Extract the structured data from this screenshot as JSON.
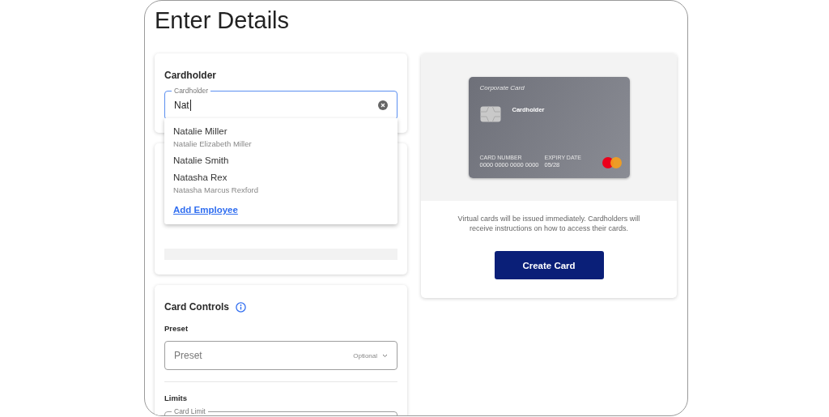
{
  "page_title": "Enter Details",
  "cardholder_section": {
    "heading": "Cardholder",
    "field": {
      "label": "Cardholder",
      "value": "Nat",
      "focused": true
    },
    "suggestions": [
      {
        "kind": "person",
        "name": "Natalie Miller",
        "full_name": "Natalie Elizabeth Miller"
      },
      {
        "kind": "person",
        "name": "Natalie Smith"
      },
      {
        "kind": "person",
        "name": "Natasha Rex",
        "full_name": "Natasha Marcus Rexford"
      },
      {
        "kind": "action",
        "name": "Add Employee"
      }
    ]
  },
  "card_controls": {
    "heading": "Card Controls",
    "preset_label": "Preset",
    "preset_field": {
      "placeholder": "Preset",
      "hint": "Optional"
    },
    "limits_label": "Limits",
    "card_limit_field": {
      "label": "Card Limit"
    }
  },
  "card_preview": {
    "card_type": "Corporate Card",
    "cardholder": "Cardholder",
    "number_label": "CARD NUMBER",
    "number": "0000 0000 0000 0000",
    "expiry_label": "EXPIRY DATE",
    "expiry": "05/28"
  },
  "notice": "Virtual cards will be issued immediately. Cardholders will receive instructions on how to access their cards.",
  "create_button": "Create Card"
}
